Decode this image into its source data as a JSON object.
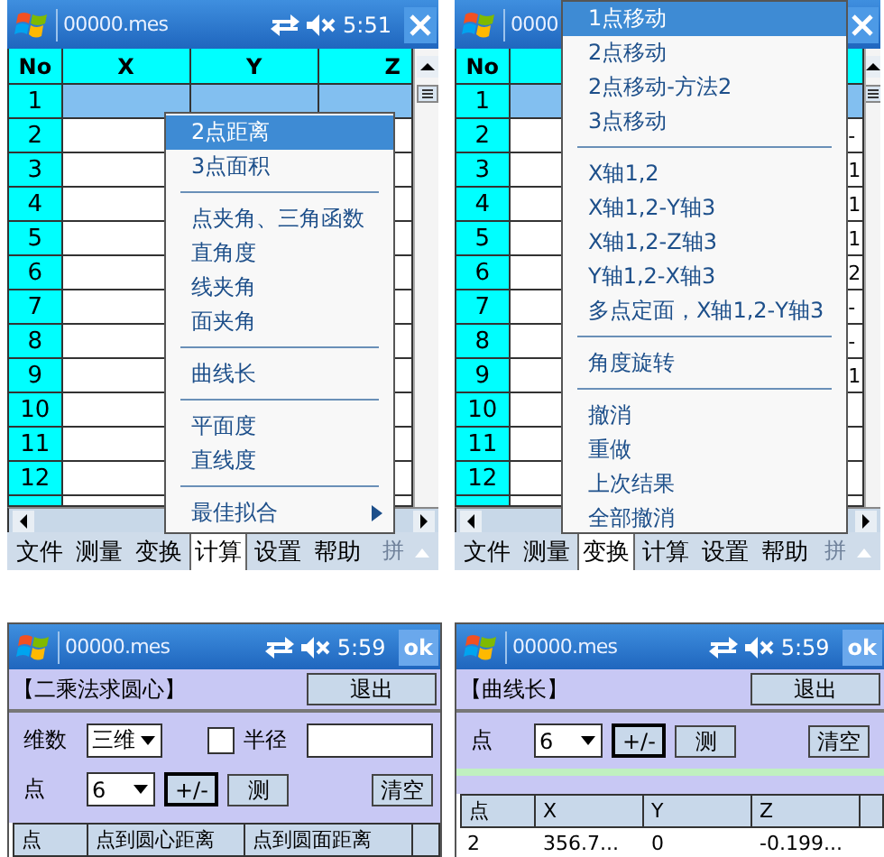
{
  "panels": [
    {
      "kind": "table_menu",
      "title_bar": {
        "title": "00000.mes",
        "status_icons": true,
        "time": "5:51",
        "close": true
      },
      "table": {
        "columns": [
          "No",
          "X",
          "Y",
          "Z"
        ],
        "rows": [
          {
            "no": "1",
            "selected": true
          },
          {
            "no": "2",
            "selected": false
          },
          {
            "no": "3",
            "selected": false
          },
          {
            "no": "4",
            "selected": false
          },
          {
            "no": "5",
            "selected": false
          },
          {
            "no": "6",
            "selected": false
          },
          {
            "no": "7",
            "selected": false
          },
          {
            "no": "8",
            "selected": false
          },
          {
            "no": "9",
            "selected": false
          },
          {
            "no": "10",
            "selected": false
          },
          {
            "no": "11",
            "selected": false
          },
          {
            "no": "12",
            "selected": false
          }
        ]
      },
      "menu": [
        {
          "kind": "item",
          "label": "2点距离",
          "selected": true
        },
        {
          "kind": "item",
          "label": "3点面积",
          "selected": false
        },
        {
          "kind": "separator"
        },
        {
          "kind": "item",
          "label": "点夹角、三角函数",
          "selected": false
        },
        {
          "kind": "item",
          "label": "直角度",
          "selected": false
        },
        {
          "kind": "item",
          "label": "线夹角",
          "selected": false
        },
        {
          "kind": "item",
          "label": "面夹角",
          "selected": false
        },
        {
          "kind": "separator"
        },
        {
          "kind": "item",
          "label": "曲线长",
          "selected": false
        },
        {
          "kind": "separator"
        },
        {
          "kind": "item",
          "label": "平面度",
          "selected": false
        },
        {
          "kind": "item",
          "label": "直线度",
          "selected": false
        },
        {
          "kind": "separator"
        },
        {
          "kind": "submenu",
          "label": "最佳拟合",
          "selected": false
        }
      ],
      "menubar": [
        {
          "label": "文件",
          "selected": false
        },
        {
          "label": "测量",
          "selected": false
        },
        {
          "label": "变换",
          "selected": false
        },
        {
          "label": "计算",
          "selected": true
        },
        {
          "label": "设置",
          "selected": false
        },
        {
          "label": "帮助",
          "selected": false
        }
      ],
      "ime": "拼"
    },
    {
      "kind": "table_menu",
      "title_bar": {
        "title": "0000",
        "status_icons": false,
        "close": true
      },
      "table": {
        "columns": [
          "No"
        ],
        "rows": [
          {
            "no": "1",
            "selected": true
          },
          {
            "no": "2",
            "selected": false,
            "edge": "-"
          },
          {
            "no": "3",
            "selected": false,
            "edge": "1"
          },
          {
            "no": "4",
            "selected": false,
            "edge": "1"
          },
          {
            "no": "5",
            "selected": false,
            "edge": "1"
          },
          {
            "no": "6",
            "selected": false,
            "edge": "2"
          },
          {
            "no": "7",
            "selected": false,
            "edge": "-"
          },
          {
            "no": "8",
            "selected": false,
            "edge": "-"
          },
          {
            "no": "9",
            "selected": false,
            "edge": "1"
          },
          {
            "no": "10",
            "selected": false
          },
          {
            "no": "11",
            "selected": false
          },
          {
            "no": "12",
            "selected": false
          }
        ]
      },
      "menu": [
        {
          "kind": "item",
          "label": "1点移动",
          "selected": true
        },
        {
          "kind": "item",
          "label": "2点移动",
          "selected": false
        },
        {
          "kind": "item",
          "label": "2点移动-方法2",
          "selected": false
        },
        {
          "kind": "item",
          "label": "3点移动",
          "selected": false
        },
        {
          "kind": "separator"
        },
        {
          "kind": "item",
          "label": "X轴1,2",
          "selected": false
        },
        {
          "kind": "item",
          "label": "X轴1,2-Y轴3",
          "selected": false
        },
        {
          "kind": "item",
          "label": "X轴1,2-Z轴3",
          "selected": false
        },
        {
          "kind": "item",
          "label": "Y轴1,2-X轴3",
          "selected": false
        },
        {
          "kind": "item",
          "label": "多点定面，X轴1,2-Y轴3",
          "selected": false
        },
        {
          "kind": "separator"
        },
        {
          "kind": "item",
          "label": "角度旋转",
          "selected": false
        },
        {
          "kind": "separator"
        },
        {
          "kind": "item",
          "label": "撤消",
          "selected": false
        },
        {
          "kind": "item",
          "label": "重做",
          "selected": false
        },
        {
          "kind": "item",
          "label": "上次结果",
          "selected": false
        },
        {
          "kind": "item",
          "label": "全部撤消",
          "selected": false
        }
      ],
      "menubar": [
        {
          "label": "文件",
          "selected": false
        },
        {
          "label": "测量",
          "selected": false
        },
        {
          "label": "变换",
          "selected": true
        },
        {
          "label": "计算",
          "selected": false
        },
        {
          "label": "设置",
          "selected": false
        },
        {
          "label": "帮助",
          "selected": false
        }
      ],
      "ime": "拼"
    },
    {
      "kind": "form",
      "title_bar": {
        "title": "00000.mes",
        "status_icons": true,
        "time": "5:59",
        "ok": "ok"
      },
      "heading": "【二乘法求圆心】",
      "exit": "退出",
      "dimension": {
        "label": "维数",
        "value": "三维"
      },
      "radius": {
        "label": "半径",
        "checked": false
      },
      "point": {
        "label": "点",
        "value": "6"
      },
      "buttons": [
        {
          "label": "+/-",
          "kind": "toggle"
        },
        {
          "label": "测",
          "kind": "plain"
        },
        {
          "label": "清空",
          "kind": "right"
        }
      ],
      "strip": false,
      "table": {
        "columns": [
          "点",
          "点到圆心距离",
          "点到圆面距离"
        ]
      }
    },
    {
      "kind": "form",
      "title_bar": {
        "title": "00000.mes",
        "status_icons": true,
        "time": "5:59",
        "ok": "ok"
      },
      "heading": "【曲线长】",
      "exit": "退出",
      "point": {
        "label": "点",
        "value": "6"
      },
      "buttons": [
        {
          "label": "+/-",
          "kind": "toggle"
        },
        {
          "label": "测",
          "kind": "plain"
        },
        {
          "label": "清空",
          "kind": "right"
        }
      ],
      "strip": true,
      "table": {
        "columns": [
          "点",
          "X",
          "Y",
          "Z"
        ],
        "rows": [
          [
            "2",
            "356.7...",
            "0",
            "-0.199..."
          ]
        ]
      }
    }
  ]
}
